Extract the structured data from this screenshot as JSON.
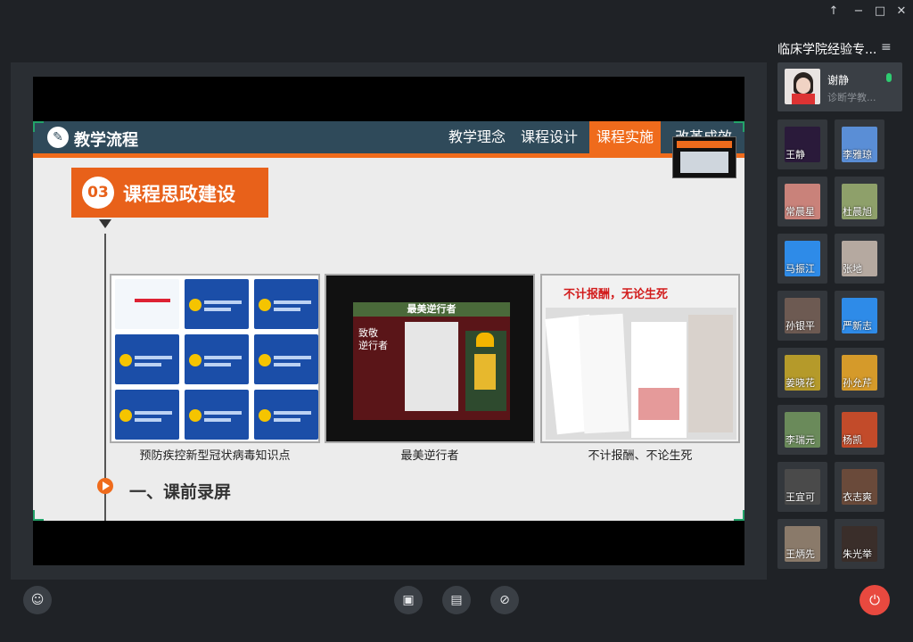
{
  "window": {
    "pin_icon": "pin-icon",
    "minimize_icon": "minimize-icon",
    "maximize_icon": "maximize-icon",
    "close_icon": "close-icon"
  },
  "slide": {
    "title": "教学流程",
    "nav": [
      "教学理念",
      "课程设计",
      "课程实施",
      "改革成效"
    ],
    "active_nav": "课程实施",
    "section_number": "03",
    "section_title": "课程思政建设",
    "thumb_captions": [
      "预防疾控新型冠状病毒知识点",
      "最美逆行者",
      "不计报酬、不论生死"
    ],
    "thumb2_banner": "最美逆行者",
    "thumb2_left_text": "致敬\n逆行者",
    "thumb3_headline": "不计报酬，无论生死",
    "subsection_title": "一、课前录屏"
  },
  "sidebar": {
    "conference_title": "临床学院经验专...",
    "speaker": {
      "name": "谢静",
      "subtitle": "诊断学教..."
    },
    "participants": [
      "王静",
      "李雅琼",
      "常晨星",
      "杜晨旭",
      "马振江",
      "张地",
      "孙银平",
      "严新志",
      "姜晓花",
      "孙允芹",
      "李瑞元",
      "杨凯",
      "王宜可",
      "衣志爽",
      "王炳先",
      "朱光举"
    ]
  },
  "toolbar": {
    "participants_icon": "people-icon",
    "share_icon": "screen-share-icon",
    "file_icon": "file-share-icon",
    "mic_icon": "mic-muted-icon",
    "end_icon": "power-icon"
  },
  "colors": {
    "accent": "#ef6b1c",
    "header_bg": "#2f4a5a",
    "end_button": "#e8493f",
    "frame_corner": "#23a36a"
  }
}
